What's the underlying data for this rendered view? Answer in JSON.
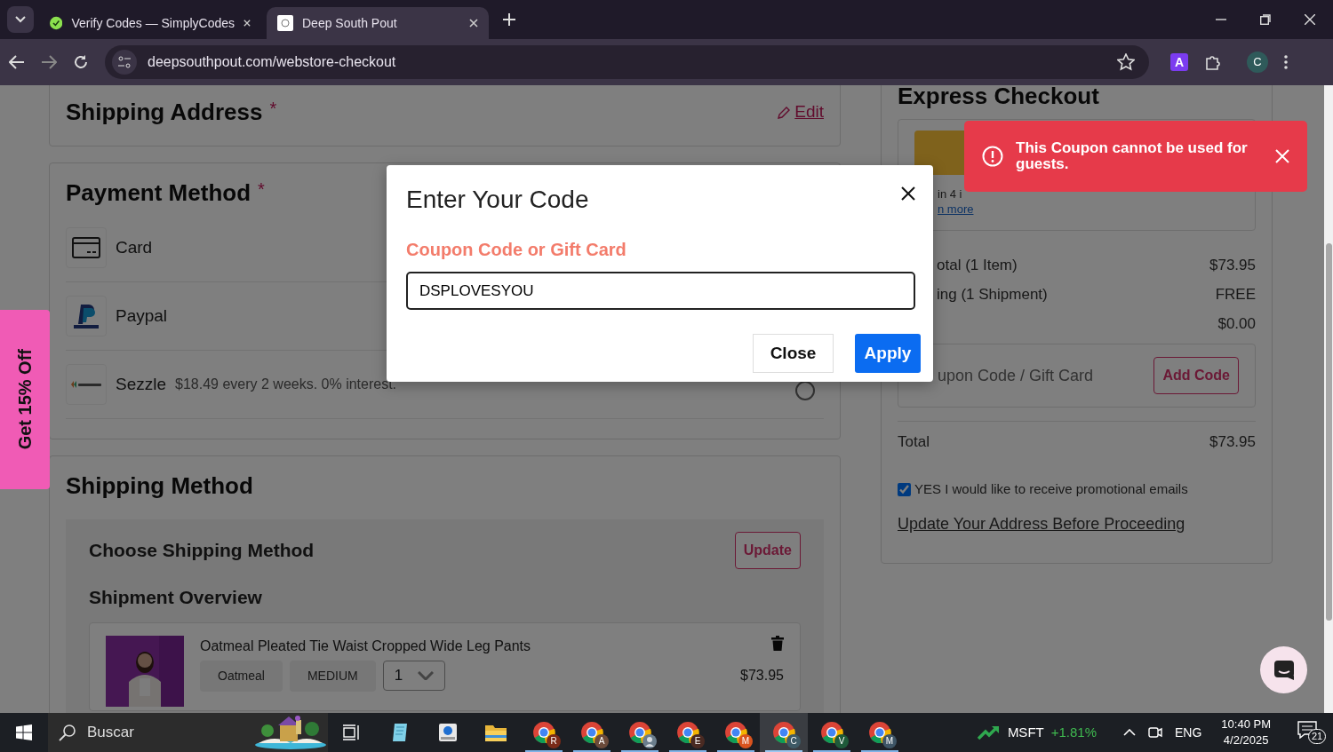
{
  "browser": {
    "tabs": [
      {
        "title": "Verify Codes — SimplyCodes",
        "selected": false
      },
      {
        "title": "Deep South Pout",
        "selected": true
      }
    ],
    "url": "deepsouthpout.com/webstore-checkout",
    "extension_letter": "A",
    "profile_letter": "C"
  },
  "checkout": {
    "shipping_address": {
      "title": "Shipping Address",
      "required": "*",
      "edit": "Edit"
    },
    "payment_method": {
      "title": "Payment Method",
      "required": "*",
      "options": [
        {
          "kind": "card",
          "label": "Card"
        },
        {
          "kind": "paypal",
          "label": "Paypal"
        },
        {
          "kind": "sezzle",
          "label": "Sezzle",
          "detail": "$18.49 every 2 weeks. 0% interest.",
          "selected": false
        }
      ]
    },
    "shipping_method": {
      "title": "Shipping Method",
      "choose": "Choose Shipping Method",
      "update": "Update",
      "overview": "Shipment Overview",
      "item": {
        "name": "Oatmeal Pleated Tie Waist Cropped Wide Leg Pants",
        "variant": "Oatmeal",
        "size": "MEDIUM",
        "quantity": "1",
        "price": "$73.95"
      }
    }
  },
  "summary": {
    "title": "Express Checkout",
    "installments": "in 4 i",
    "learn_more": "n more",
    "lines": [
      {
        "label": "otal (1 Item)",
        "value": "$73.95"
      },
      {
        "label": "ing (1 Shipment)",
        "value": "FREE"
      },
      {
        "value": "$0.00"
      }
    ],
    "coupon_label": "upon Code / Gift Card",
    "add_code": "Add Code",
    "total_label": "Total",
    "total": "$73.95",
    "promo_optin": {
      "label": "YES I would like to receive promotional emails",
      "checked": true
    },
    "update_link": "Update Your Address Before Proceeding"
  },
  "promo_tab": "Get 15% Off",
  "modal": {
    "title": "Enter Your Code",
    "label": "Coupon Code or Gift Card",
    "value": "DSPLOVESYOU",
    "close": "Close",
    "apply": "Apply"
  },
  "toast": {
    "message": "This Coupon cannot be used for guests."
  },
  "taskbar": {
    "search_placeholder": "Buscar",
    "pinned": [
      {
        "kind": "taskview"
      },
      {
        "kind": "notepad"
      },
      {
        "kind": "app"
      },
      {
        "kind": "folder"
      }
    ],
    "chrome_windows": [
      {
        "badge": "R",
        "selected": false
      },
      {
        "badge": "A",
        "selected": false
      },
      {
        "selected": false
      },
      {
        "badge": "E",
        "selected": false
      },
      {
        "badge": "M",
        "selected": false
      },
      {
        "badge": "C",
        "selected": true
      },
      {
        "badge": "V",
        "selected": false
      },
      {
        "badge": "M",
        "selected": false
      }
    ],
    "stock": {
      "symbol": "MSFT",
      "change": "+1.81%"
    },
    "language": "ENG",
    "time": "10:40 PM",
    "date": "4/2/2025",
    "notifications": "21"
  }
}
